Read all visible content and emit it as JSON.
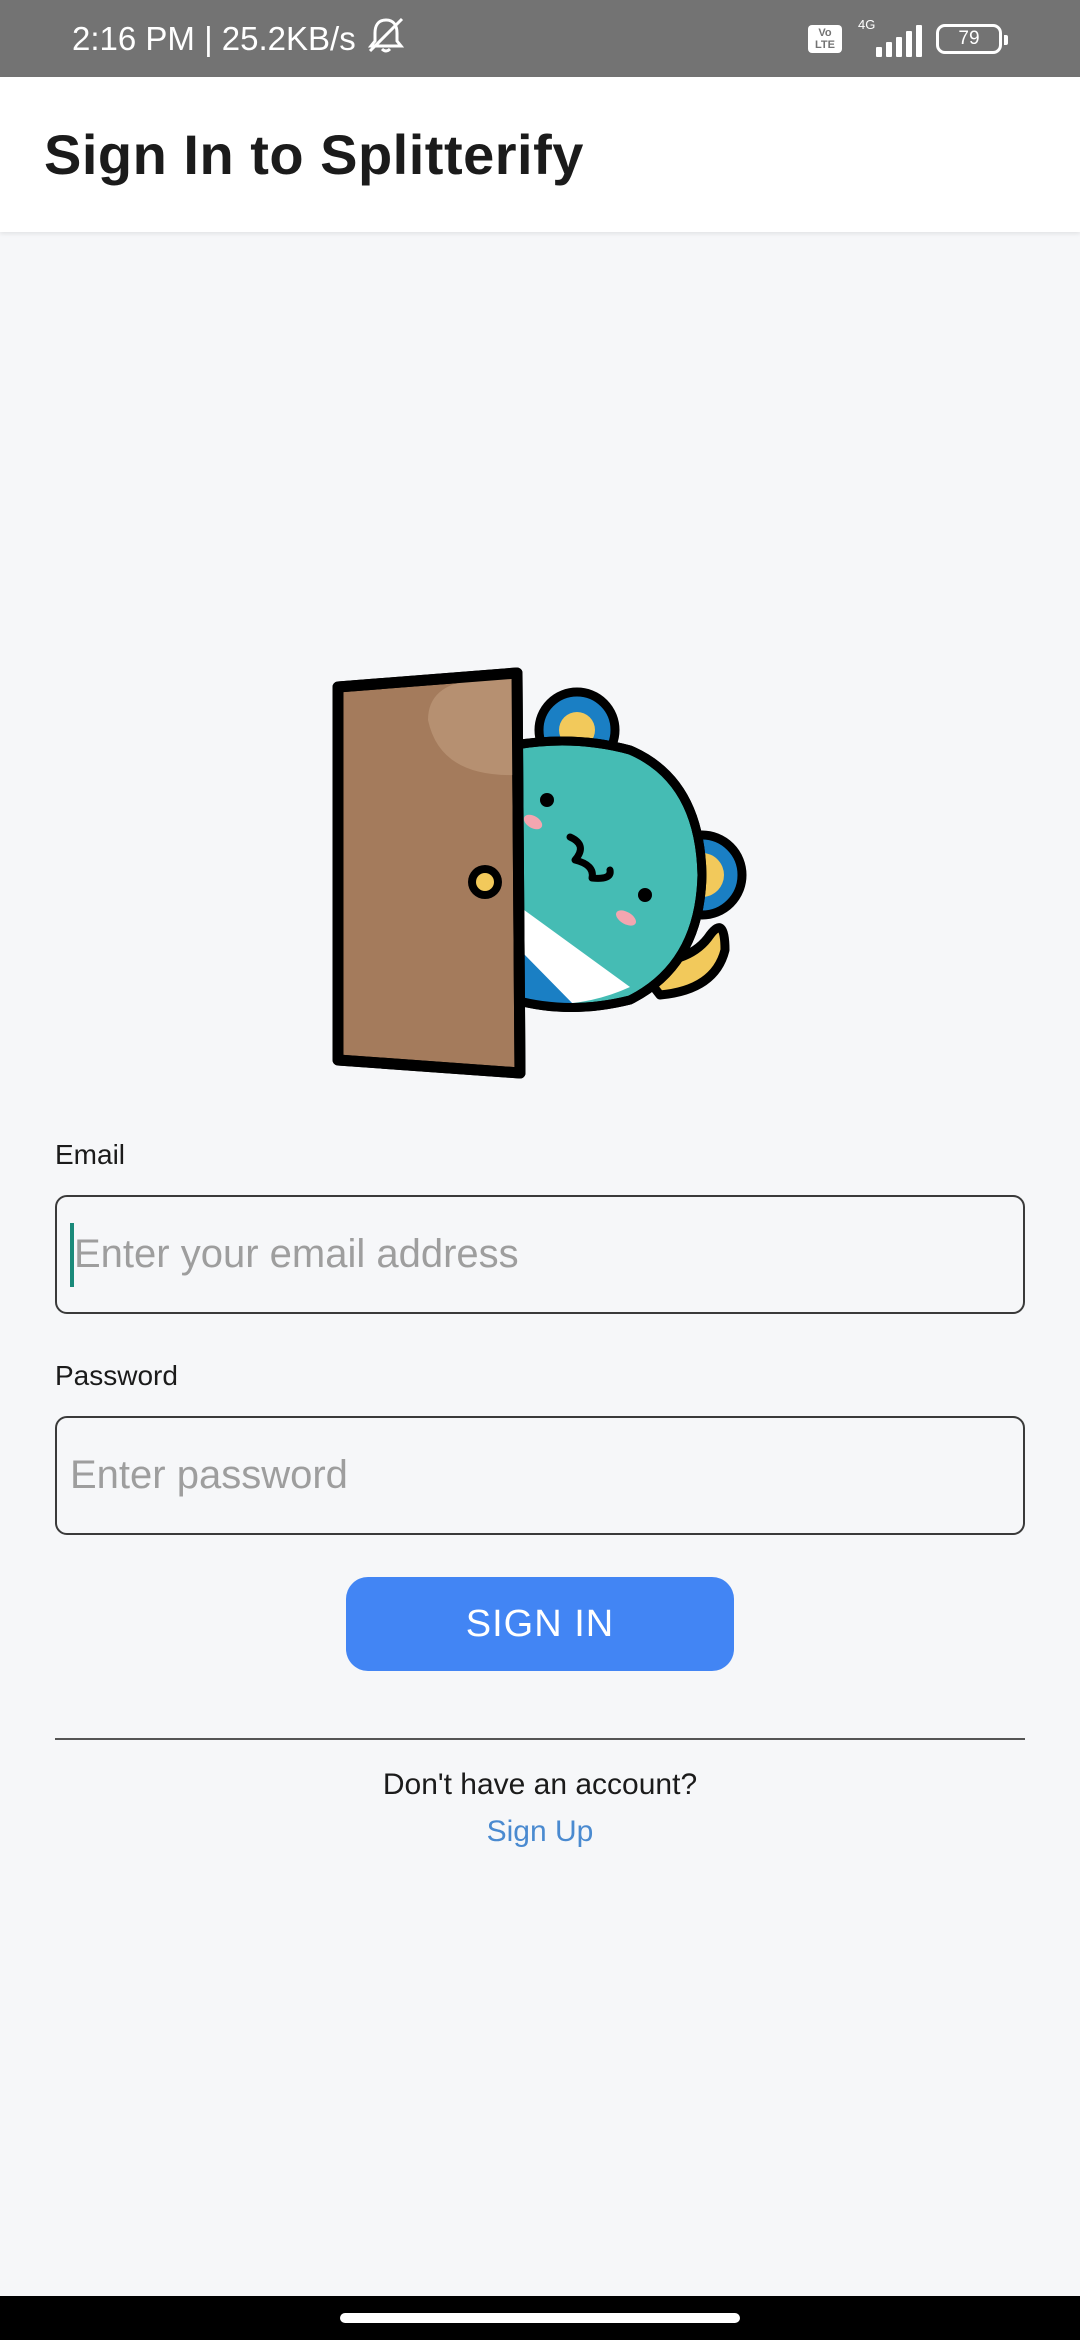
{
  "status_bar": {
    "time_speed": "2:16 PM | 25.2KB/s",
    "volte_label_top": "Vo",
    "volte_label_bottom": "LTE",
    "network_label": "4G",
    "battery": "79"
  },
  "app_bar": {
    "title": "Sign In to Splitterify"
  },
  "illustration": {
    "icon": "frog-peeking-behind-door",
    "colors": {
      "door": "#a47b5c",
      "frog": "#45bcb4",
      "ear": "#f2c95b",
      "ear_ring": "#1a7fc4",
      "shirt_blue": "#1a7fc4"
    }
  },
  "form": {
    "email_label": "Email",
    "email_placeholder": "Enter your email address",
    "email_value": "",
    "password_label": "Password",
    "password_placeholder": "Enter password",
    "password_value": "",
    "sign_in_label": "SIGN IN"
  },
  "footer": {
    "account_prompt": "Don't have an account?",
    "sign_up_label": "Sign Up"
  },
  "colors": {
    "accent": "#4285f4",
    "link": "#4a8ad0",
    "caret": "#1a8a7a",
    "status_bar": "#737373"
  }
}
